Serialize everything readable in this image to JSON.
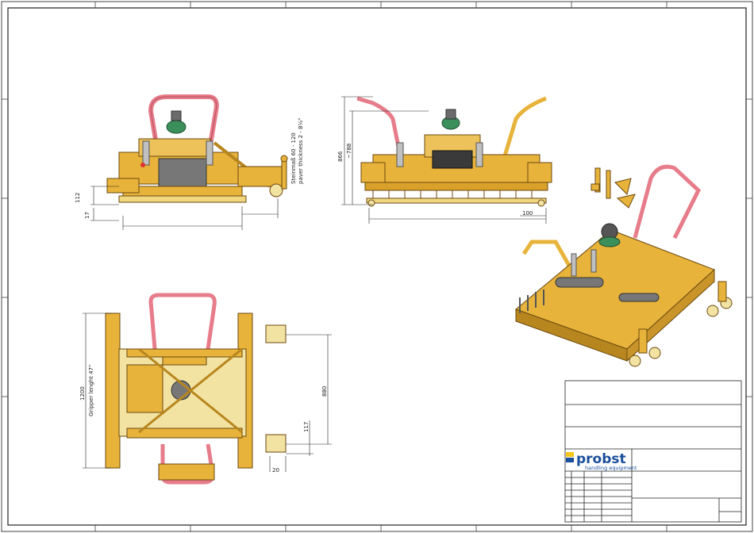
{
  "drawing": {
    "side_view": {
      "dim_height_1": "112",
      "dim_height_2": "17",
      "paver_note_line1": "Steinmaß 60 - 120",
      "paver_note_line2": "paver thickness 2 - 8½\""
    },
    "front_view": {
      "dim_height_1": "866",
      "dim_height_2": "~788",
      "dim_width": "100"
    },
    "top_view": {
      "dim_length": "1200",
      "gripper_note": "Gripper lenght 47\"",
      "dim_width": "880",
      "dim_small": "117",
      "dim_tiny": "20"
    }
  },
  "title_block": {
    "brand": "probst",
    "tagline": "handling equipment"
  },
  "colors": {
    "machine_yellow": "#e8b33a",
    "machine_dark": "#b8861e",
    "pink_handle": "#e77c8a",
    "brand_blue": "#1b4f9c",
    "brand_yellow": "#f5c518"
  }
}
